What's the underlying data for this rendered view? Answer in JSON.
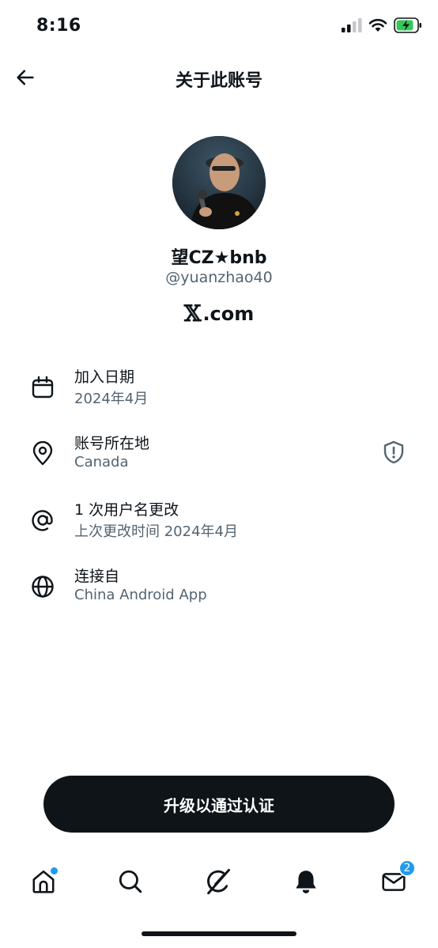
{
  "status_bar": {
    "time": "8:16",
    "battery_color": "#34c759"
  },
  "header": {
    "title": "关于此账号",
    "back_icon": "arrow-left-icon"
  },
  "profile": {
    "display_name": "望CZ★bnb",
    "handle": "@yuanzhao40",
    "brand_x": "𝕏",
    "brand_domain": ".com"
  },
  "info": [
    {
      "icon": "calendar-icon",
      "title": "加入日期",
      "subtitle": "2024年4月"
    },
    {
      "icon": "location-pin-icon",
      "title": "账号所在地",
      "subtitle": "Canada",
      "trailing_icon": "shield-alert-icon"
    },
    {
      "icon": "at-sign-icon",
      "title": "1 次用户名更改",
      "subtitle": "上次更改时间 2024年4月"
    },
    {
      "icon": "globe-icon",
      "title": "连接自",
      "subtitle": "China Android App"
    }
  ],
  "cta": {
    "label": "升级以通过认证"
  },
  "tab_bar": {
    "tabs": [
      {
        "icon": "home-icon",
        "has_dot": true
      },
      {
        "icon": "search-icon"
      },
      {
        "icon": "grok-icon"
      },
      {
        "icon": "bell-icon"
      },
      {
        "icon": "mail-icon",
        "badge": "2"
      }
    ],
    "accent": "#1d9bf0"
  }
}
